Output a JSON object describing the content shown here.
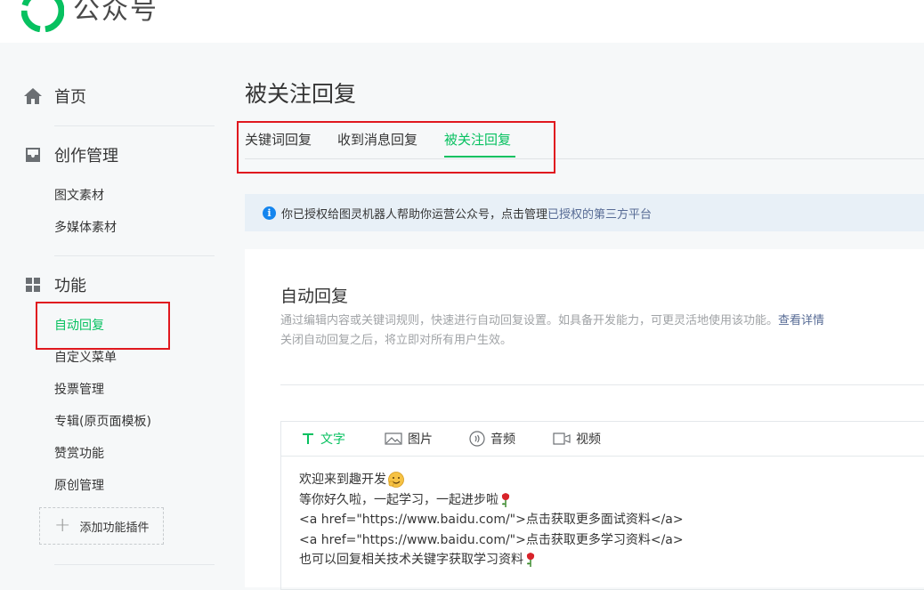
{
  "brand": {
    "name": "公众号",
    "logo_icon": "wechat-mp-logo-icon"
  },
  "sidebar": {
    "home": {
      "label": "首页",
      "icon": "home-icon"
    },
    "creation": {
      "label": "创作管理",
      "icon": "inbox-icon",
      "items": [
        "图文素材",
        "多媒体素材"
      ]
    },
    "features": {
      "label": "功能",
      "icon": "grid-icon",
      "items": [
        "自动回复",
        "自定义菜单",
        "投票管理",
        "专辑(原页面模板)",
        "赞赏功能",
        "原创管理"
      ],
      "active_index": 0
    },
    "add_plugin": "添加功能插件"
  },
  "page": {
    "title": "被关注回复",
    "tabs": [
      "关键词回复",
      "收到消息回复",
      "被关注回复"
    ],
    "active_tab": 2
  },
  "notice": {
    "text_before": "你已授权给图灵机器人帮助你运营公众号，点击管理",
    "link": "已授权的第三方平台"
  },
  "auto_reply": {
    "title": "自动回复",
    "desc_line1": "通过编辑内容或关键词规则，快速进行自动回复设置。如具备开发能力，可更灵活地使用该功能。",
    "desc_link": "查看详情",
    "desc_line2": "关闭自动回复之后，将立即对所有用户生效。"
  },
  "editor": {
    "tabs": [
      {
        "label": "文字",
        "icon": "text-icon"
      },
      {
        "label": "图片",
        "icon": "image-icon"
      },
      {
        "label": "音频",
        "icon": "audio-icon"
      },
      {
        "label": "视频",
        "icon": "video-icon"
      }
    ],
    "active_tab": 0,
    "lines": [
      "欢迎来到趣开发",
      "等你好久啦，一起学习，一起进步啦",
      "<a href=\"https://www.baidu.com/\">点击获取更多面试资料</a>",
      "<a href=\"https://www.baidu.com/\">点击获取更多学习资料</a>",
      "也可以回复相关技术关键字获取学习资料"
    ]
  },
  "colors": {
    "accent": "#07c160",
    "link": "#576b95",
    "highlight_box": "#e0181f",
    "notice_bg": "#e8f0f7"
  }
}
